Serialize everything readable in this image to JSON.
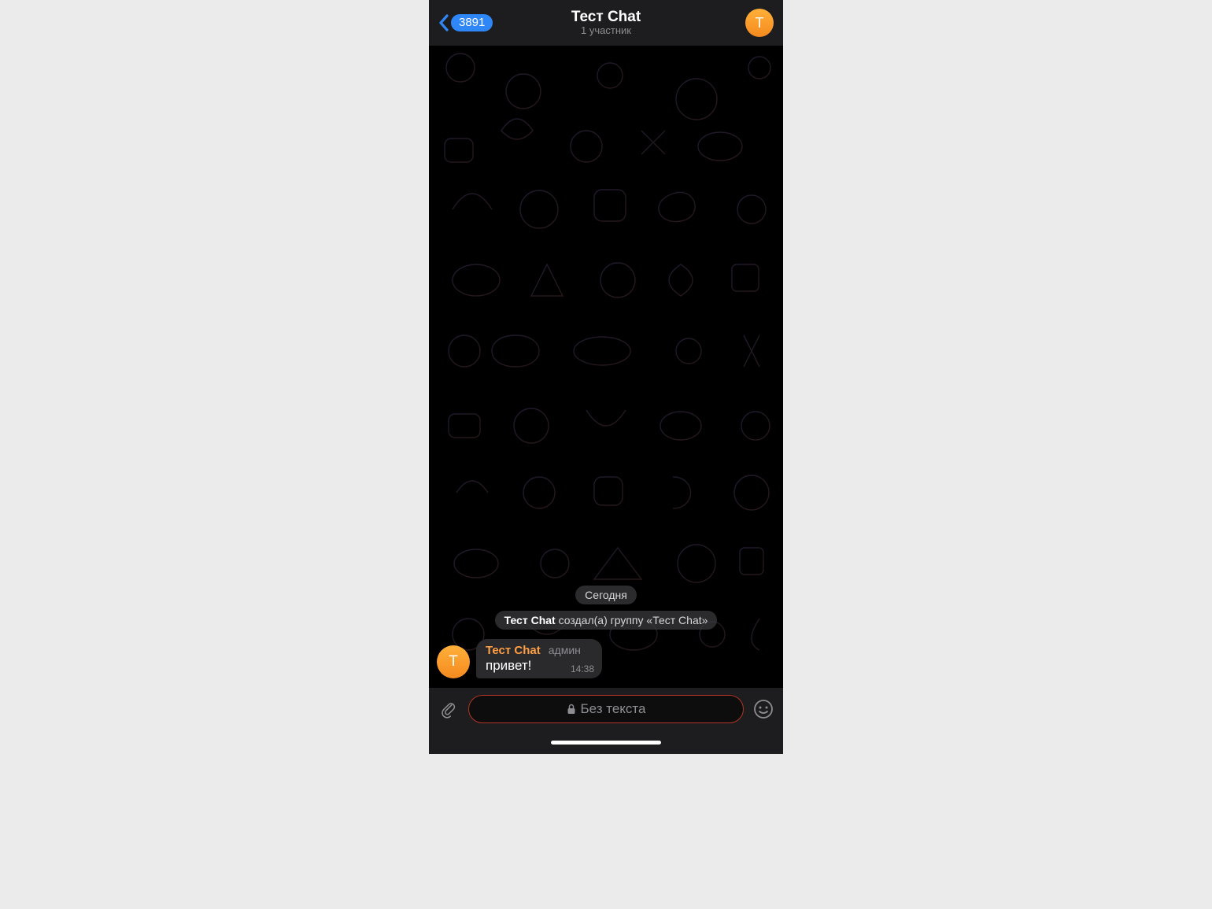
{
  "header": {
    "back_badge": "3891",
    "title": "Тест Chat",
    "subtitle": "1 участник",
    "avatar_letter": "T"
  },
  "chat": {
    "date_label": "Сегодня",
    "system_actor": "Тест Chat",
    "system_rest": " создал(а) группу «Тест Chat»",
    "message": {
      "sender": "Тест Chat",
      "role": "админ",
      "text": "привет!",
      "time": "14:38",
      "avatar_letter": "T"
    }
  },
  "input": {
    "placeholder": "Без текста"
  }
}
